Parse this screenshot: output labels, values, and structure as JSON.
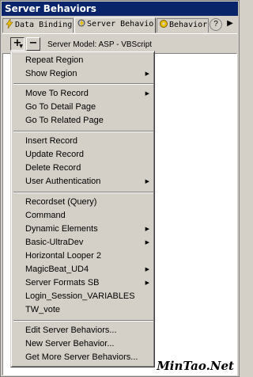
{
  "window": {
    "title": "Server Behaviors"
  },
  "tabs": [
    {
      "label": "Data Bindings",
      "icon": "lightning-icon",
      "active": false
    },
    {
      "label": "Server Behaviors",
      "icon": "gear-lightning-icon",
      "active": true
    },
    {
      "label": "Behaviors",
      "icon": "gear-icon",
      "active": false
    }
  ],
  "tab_controls": {
    "help": "?",
    "arrow": "▶"
  },
  "toolbar": {
    "add_label": "+",
    "remove_label": "−",
    "model_text": "Server Model: ASP - VBScript"
  },
  "menu": {
    "groups": [
      {
        "items": [
          {
            "label": "Repeat Region",
            "submenu": false
          },
          {
            "label": "Show Region",
            "submenu": true
          }
        ]
      },
      {
        "items": [
          {
            "label": "Move To Record",
            "submenu": true
          },
          {
            "label": "Go To Detail Page",
            "submenu": false
          },
          {
            "label": "Go To Related Page",
            "submenu": false
          }
        ]
      },
      {
        "items": [
          {
            "label": "Insert Record",
            "submenu": false
          },
          {
            "label": "Update Record",
            "submenu": false
          },
          {
            "label": "Delete Record",
            "submenu": false
          },
          {
            "label": "User Authentication",
            "submenu": true
          }
        ]
      },
      {
        "items": [
          {
            "label": "Recordset (Query)",
            "submenu": false
          },
          {
            "label": "Command",
            "submenu": false
          },
          {
            "label": "Dynamic Elements",
            "submenu": true
          },
          {
            "label": "Basic-UltraDev",
            "submenu": true
          },
          {
            "label": "Horizontal Looper 2",
            "submenu": false
          },
          {
            "label": "MagicBeat_UD4",
            "submenu": true
          },
          {
            "label": "Server Formats SB",
            "submenu": true
          },
          {
            "label": "Login_Session_VARIABLES",
            "submenu": false
          },
          {
            "label": "TW_vote",
            "submenu": false
          }
        ]
      },
      {
        "items": [
          {
            "label": "Edit Server Behaviors...",
            "submenu": false
          },
          {
            "label": "New Server Behavior...",
            "submenu": false
          },
          {
            "label": "Get More Server Behaviors...",
            "submenu": false
          }
        ]
      }
    ],
    "submenu_arrow": "▶"
  },
  "watermark": "MinTao.Net",
  "colors": {
    "titlebar": "#0a246a",
    "face": "#d4d0c8",
    "list_bg": "#ffffff"
  }
}
